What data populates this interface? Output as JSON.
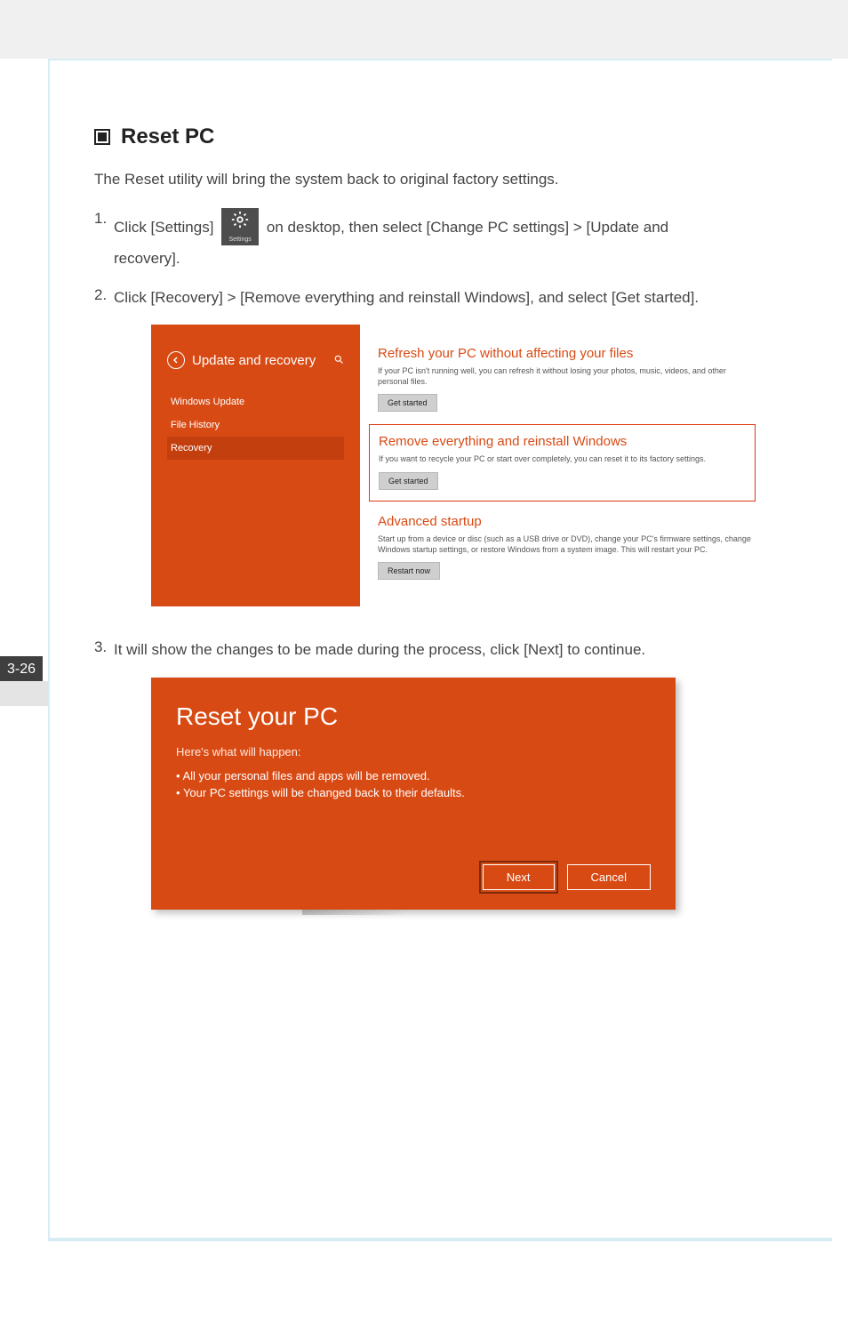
{
  "page_number_tab": "3-26",
  "section": {
    "title": "Reset PC",
    "intro": "The Reset utility will bring the system back to original factory settings."
  },
  "steps": {
    "s1_num": "1.",
    "s1_a": "Click [Settings]",
    "s1_b": "on desktop, then select [Change PC settings] > [Update and",
    "s1_c": "recovery].",
    "settings_tile_label": "Settings",
    "s2_num": "2.",
    "s2": "Click [Recovery] > [Remove everything and reinstall Windows], and select [Get started].",
    "s3_num": "3.",
    "s3": "It will show the changes to be made during the process, click [Next] to continue."
  },
  "shot1": {
    "left": {
      "title": "Update and recovery",
      "nav": {
        "windows_update": "Windows Update",
        "file_history": "File History",
        "recovery": "Recovery"
      }
    },
    "right": {
      "refresh": {
        "title": "Refresh your PC without affecting your files",
        "desc": "If your PC isn't running well, you can refresh it without losing your photos, music, videos, and other personal files.",
        "btn": "Get started"
      },
      "remove": {
        "title": "Remove everything and reinstall Windows",
        "desc": "If you want to recycle your PC or start over completely, you can reset it to its factory settings.",
        "btn": "Get started"
      },
      "advanced": {
        "title": "Advanced startup",
        "desc": "Start up from a device or disc (such as a USB drive or DVD), change your PC's firmware settings, change Windows startup settings, or restore Windows from a system image. This will restart your PC.",
        "btn": "Restart now"
      }
    }
  },
  "shot2": {
    "title": "Reset your PC",
    "subtitle": "Here's what will happen:",
    "bullets": {
      "b1": "All your personal files and apps will be removed.",
      "b2": "Your PC settings will be changed back to their defaults."
    },
    "buttons": {
      "next": "Next",
      "cancel": "Cancel"
    }
  }
}
